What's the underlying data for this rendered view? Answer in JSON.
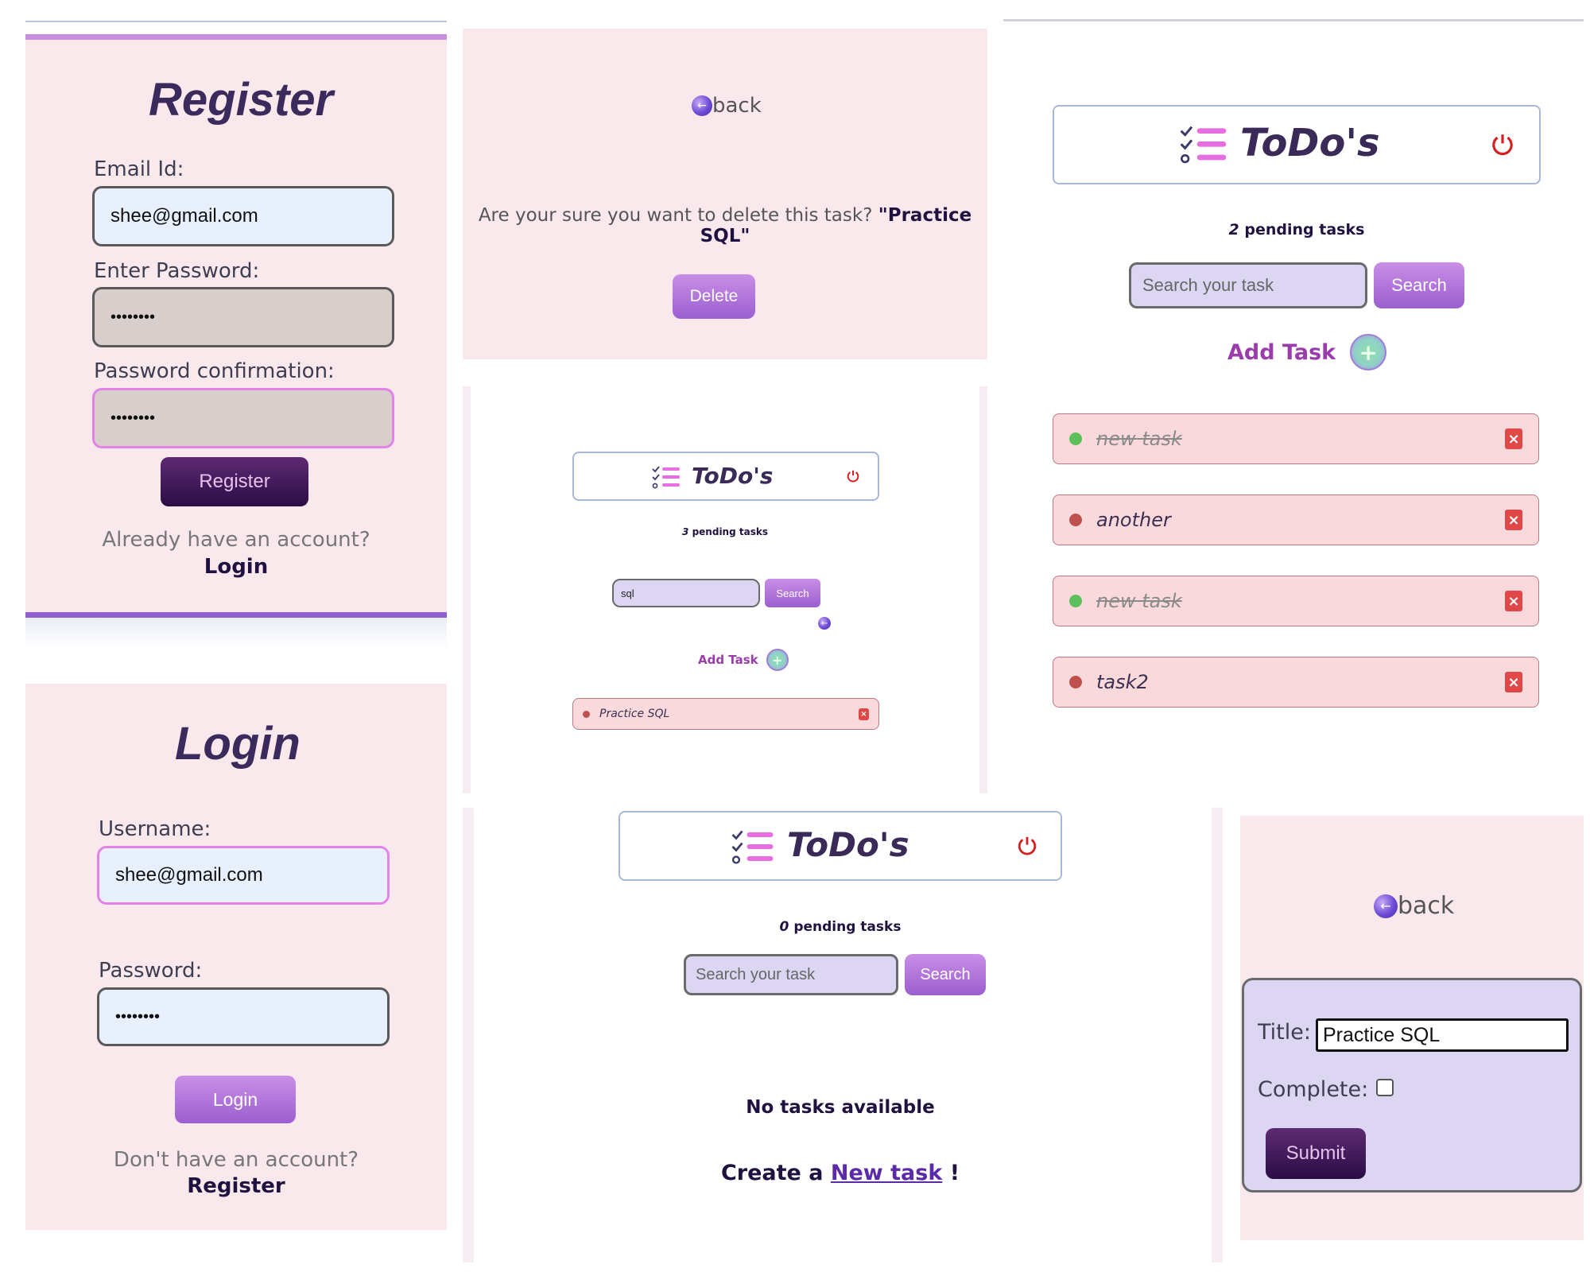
{
  "register": {
    "title": "Register",
    "email_label": "Email Id:",
    "email_value": "shee@gmail.com",
    "password_label": "Enter Password:",
    "password_value": "••••••••",
    "confirm_label": "Password confirmation:",
    "confirm_value": "••••••••",
    "submit_label": "Register",
    "prompt": "Already have an account?",
    "login_link": "Login"
  },
  "login": {
    "title": "Login",
    "username_label": "Username:",
    "username_value": "shee@gmail.com",
    "password_label": "Password:",
    "password_value": "••••••••",
    "submit_label": "Login",
    "prompt": "Don't have an account?",
    "register_link": "Register"
  },
  "delete_page": {
    "back_label": "back",
    "question": "Are your sure you want to delete this task?",
    "task_name": "\"Practice SQL\"",
    "delete_label": "Delete"
  },
  "todo_app": {
    "title": "ToDo's",
    "pending_suffix": "pending tasks",
    "search_placeholder": "Search your task",
    "search_button": "Search",
    "add_task_label": "Add Task"
  },
  "small_view": {
    "pending_count": "3",
    "search_value": "sql",
    "tasks": [
      {
        "title": "Practice SQL",
        "complete": false
      }
    ]
  },
  "big_view": {
    "pending_count": "2",
    "tasks": [
      {
        "title": "new task",
        "complete": true
      },
      {
        "title": "another",
        "complete": false
      },
      {
        "title": "new task",
        "complete": true
      },
      {
        "title": "task2",
        "complete": false
      }
    ]
  },
  "empty_view": {
    "pending_count": "0",
    "empty_message": "No tasks available",
    "create_prefix": "Create a",
    "create_link": "New task",
    "create_suffix": "!"
  },
  "edit_page": {
    "back_label": "back",
    "title_label": "Title:",
    "title_value": "Practice SQL",
    "complete_label": "Complete:",
    "complete_checked": false,
    "submit_label": "Submit"
  },
  "colors": {
    "panel_bg": "#fae9ec",
    "accent_purple": "#9b5fd0",
    "dark_button": "#2a0d45",
    "task_bg": "#f9d9dc",
    "done_dot": "#5bbf5b",
    "pending_dot": "#c0504d",
    "delete_red": "#e04848"
  }
}
